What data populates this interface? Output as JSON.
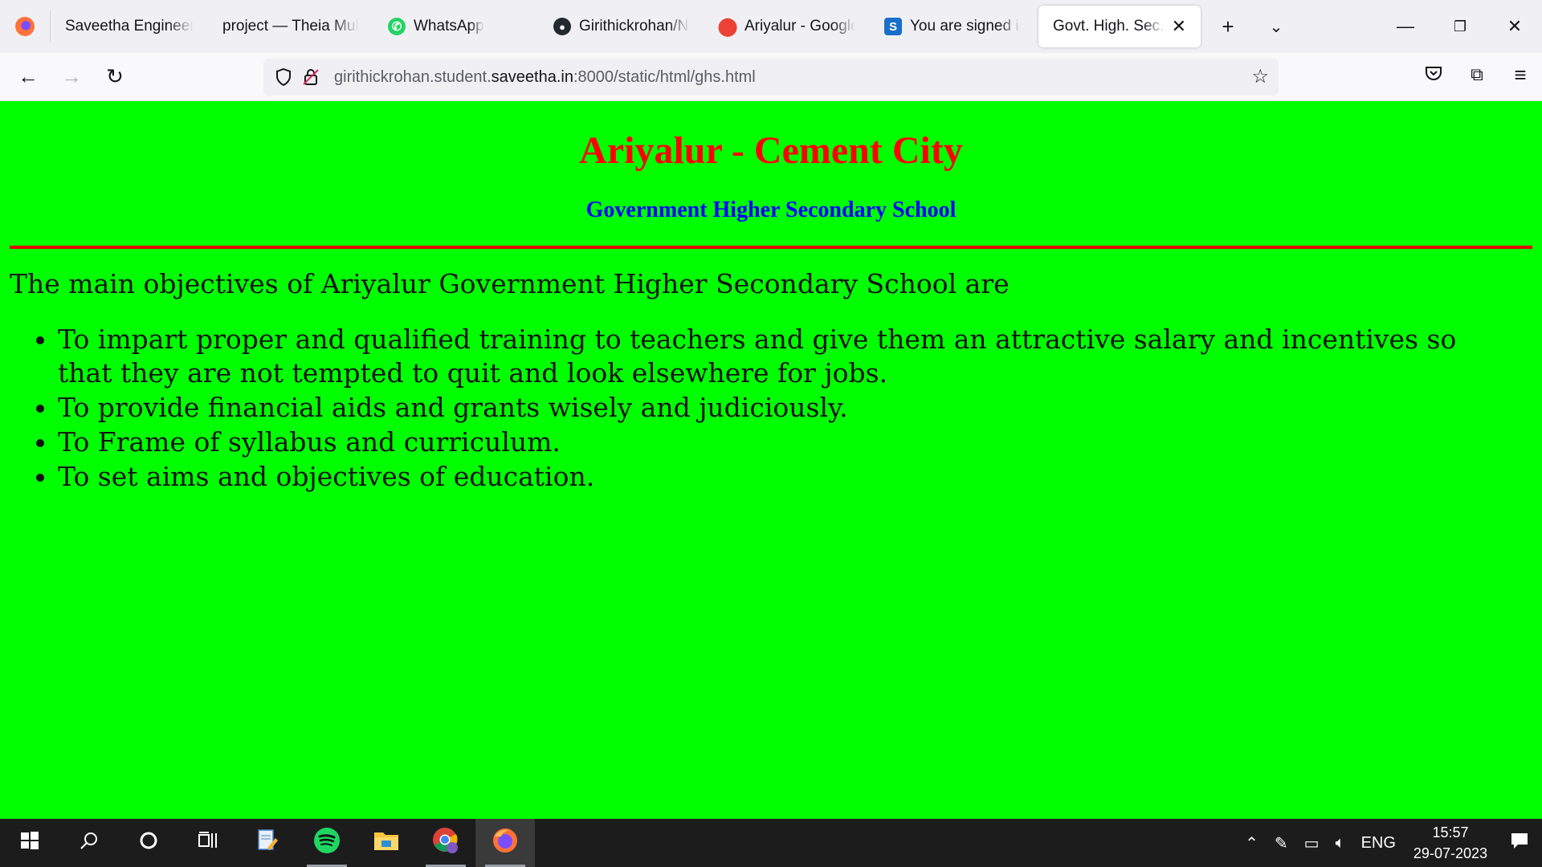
{
  "browser": {
    "tabs": [
      {
        "title": "Saveetha Engineering",
        "icon": "firefox-page-icon"
      },
      {
        "title": "project — Theia Multi-",
        "icon": "none"
      },
      {
        "title": "WhatsApp",
        "icon": "whatsapp-icon"
      },
      {
        "title": "Girithickrohan/Ne",
        "icon": "github-icon"
      },
      {
        "title": "Ariyalur - Google M",
        "icon": "maps-pin-icon"
      },
      {
        "title": "You are signed in a",
        "icon": "s-icon"
      },
      {
        "title": "Govt. High. Sec. Sch",
        "icon": "none",
        "active": true
      }
    ],
    "url": {
      "prefix": "girithickrohan.student.",
      "domain": "saveetha.in",
      "suffix": ":8000/static/html/ghs.html"
    }
  },
  "page": {
    "title": "Ariyalur - Cement City",
    "subtitle": "Government Higher Secondary School",
    "intro": "The main objectives of Ariyalur Government Higher Secondary School are",
    "objectives": [
      "To impart proper and qualified training to teachers and give them an attractive salary and incentives so that they are not tempted to quit and look elsewhere for jobs.",
      "To provide financial aids and grants wisely and judiciously.",
      "To Frame of syllabus and curriculum.",
      "To set aims and objectives of education."
    ],
    "colors": {
      "background": "#00ff00",
      "title": "#ff0000",
      "subtitle": "#0000ff",
      "rule": "#e00000"
    }
  },
  "taskbar": {
    "language": "ENG",
    "time": "15:57",
    "date": "29-07-2023"
  }
}
